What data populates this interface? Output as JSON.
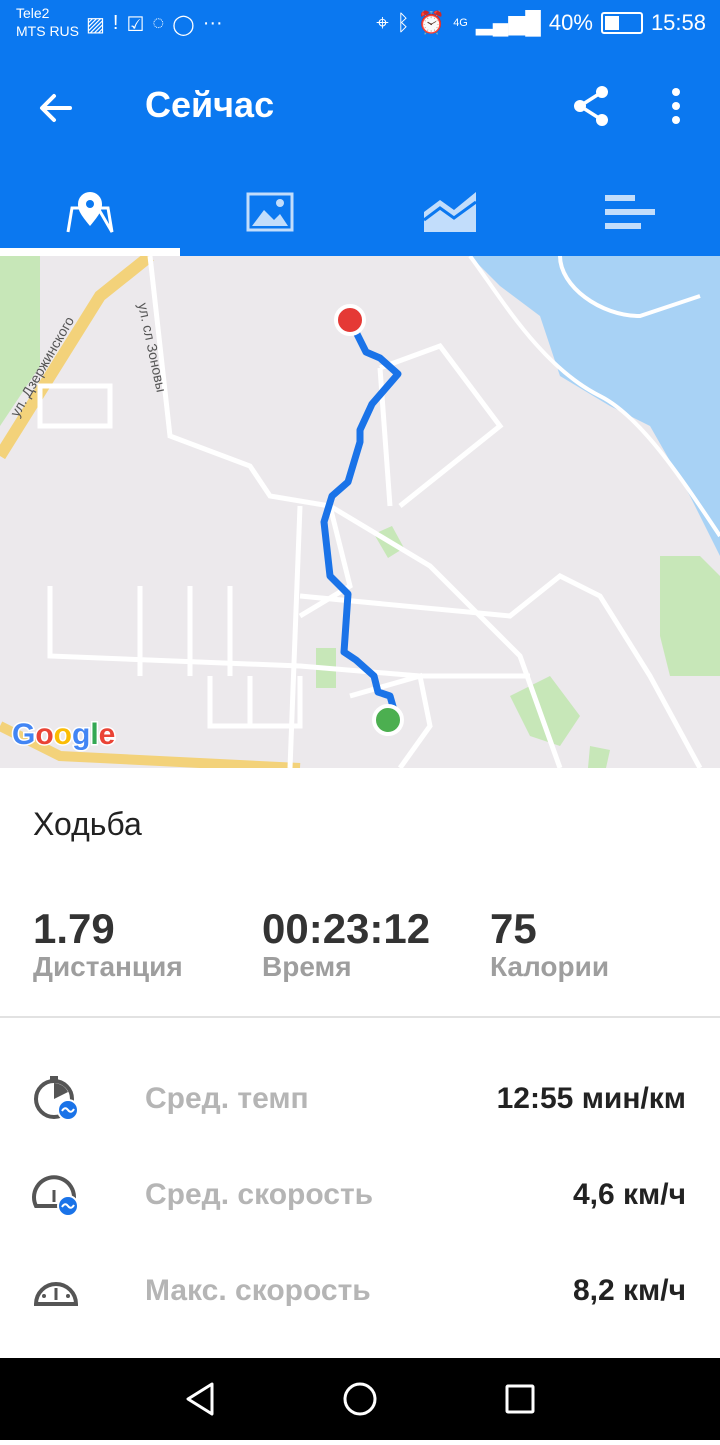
{
  "statusbar": {
    "carrier_line1": "Tele2",
    "carrier_line2": "MTS RUS",
    "battery": "40%",
    "time": "15:58",
    "network": "4G",
    "icons": [
      "pulse-icon",
      "alert-icon",
      "check-icon",
      "viber-icon",
      "whatsapp-icon",
      "more-icon",
      "location-icon",
      "bluetooth-icon",
      "alarm-icon",
      "signal-icon",
      "battery-icon"
    ]
  },
  "appbar": {
    "title": "Сейчас",
    "tabs": [
      {
        "name": "map-tab",
        "icon": "map-pin-icon",
        "active": true
      },
      {
        "name": "photos-tab",
        "icon": "image-icon",
        "active": false
      },
      {
        "name": "chart-tab",
        "icon": "area-chart-icon",
        "active": false
      },
      {
        "name": "stats-tab",
        "icon": "bars-icon",
        "active": false
      }
    ]
  },
  "map": {
    "street1": "ул. Дзержинского",
    "street2": "ул. сл Зоновы",
    "logo": "Google",
    "colors": {
      "route": "#1a73e8",
      "start": "#4caf50",
      "end": "#e53935"
    }
  },
  "activity": "Ходьба",
  "stats": [
    {
      "value": "1.79",
      "label": "Дистанция"
    },
    {
      "value": "00:23:12",
      "label": "Время"
    },
    {
      "value": "75",
      "label": "Калории"
    }
  ],
  "metrics": [
    {
      "label": "Сред. темп",
      "value": "12:55 мин/км",
      "icon": "avg-pace-icon"
    },
    {
      "label": "Сред. скорость",
      "value": "4,6 км/ч",
      "icon": "avg-speed-icon"
    },
    {
      "label": "Макс. скорость",
      "value": "8,2 км/ч",
      "icon": "max-speed-icon"
    }
  ],
  "colors": {
    "primary": "#0b78f0"
  }
}
